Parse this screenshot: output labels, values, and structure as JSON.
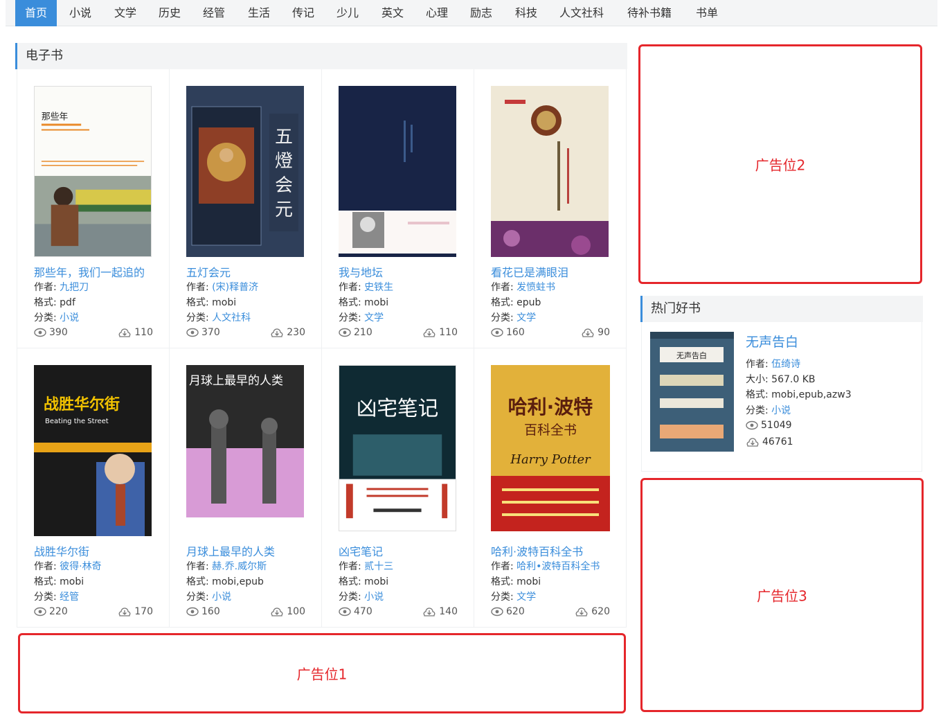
{
  "nav": {
    "items": [
      "首页",
      "小说",
      "文学",
      "历史",
      "经管",
      "生活",
      "传记",
      "少儿",
      "英文",
      "心理",
      "励志",
      "科技",
      "人文社科",
      "待补书籍",
      "书单"
    ]
  },
  "ebooks": {
    "section_title": "电子书",
    "labels": {
      "author": "作者:",
      "format": "格式:",
      "category": "分类:"
    },
    "books": [
      {
        "title": "那些年，我们一起追的",
        "author": "九把刀",
        "format": "pdf",
        "category": "小说",
        "views": "390",
        "downloads": "110"
      },
      {
        "title": "五灯会元",
        "author": "(宋)释普济",
        "format": "mobi",
        "category": "人文社科",
        "views": "370",
        "downloads": "230"
      },
      {
        "title": "我与地坛",
        "author": "史铁生",
        "format": "mobi",
        "category": "文学",
        "views": "210",
        "downloads": "110"
      },
      {
        "title": "看花已是满眼泪",
        "author": "发愤蛀书",
        "format": "epub",
        "category": "文学",
        "views": "160",
        "downloads": "90"
      },
      {
        "title": "战胜华尔街",
        "author": "彼得·林奇",
        "format": "mobi",
        "category": "经管",
        "views": "220",
        "downloads": "170"
      },
      {
        "title": "月球上最早的人类",
        "author": "赫.乔.威尔斯",
        "format": "mobi,epub",
        "category": "小说",
        "views": "160",
        "downloads": "100"
      },
      {
        "title": "凶宅笔记",
        "author": "贰十三",
        "format": "mobi",
        "category": "小说",
        "views": "470",
        "downloads": "140"
      },
      {
        "title": "哈利·波特百科全书",
        "author": "哈利•波特百科全书",
        "format": "mobi",
        "category": "文学",
        "views": "620",
        "downloads": "620"
      }
    ]
  },
  "ads": {
    "ad1": "广告位1",
    "ad2": "广告位2",
    "ad3": "广告位3"
  },
  "hot": {
    "section_title": "热门好书",
    "book": {
      "title": "无声告白",
      "author_label": "作者:",
      "author": "伍绮诗",
      "size_label": "大小:",
      "size": "567.0 KB",
      "format_label": "格式:",
      "format": "mobi,epub,azw3",
      "category_label": "分类:",
      "category": "小说",
      "views": "51049",
      "downloads": "46761"
    }
  },
  "cover_text": {
    "b1": "那些年",
    "b2": "五燈会元",
    "b5": "战胜华尔街",
    "b5en": "Beating the Street",
    "b6": "月球上最早的人类",
    "b7": "凶宅笔记",
    "b8a": "哈利·波特",
    "b8b": "百科全书",
    "b8c": "Harry Potter",
    "hot": "无声告白"
  },
  "colors": {
    "accent": "#3a8ddb",
    "ad_red": "#e5262b"
  }
}
